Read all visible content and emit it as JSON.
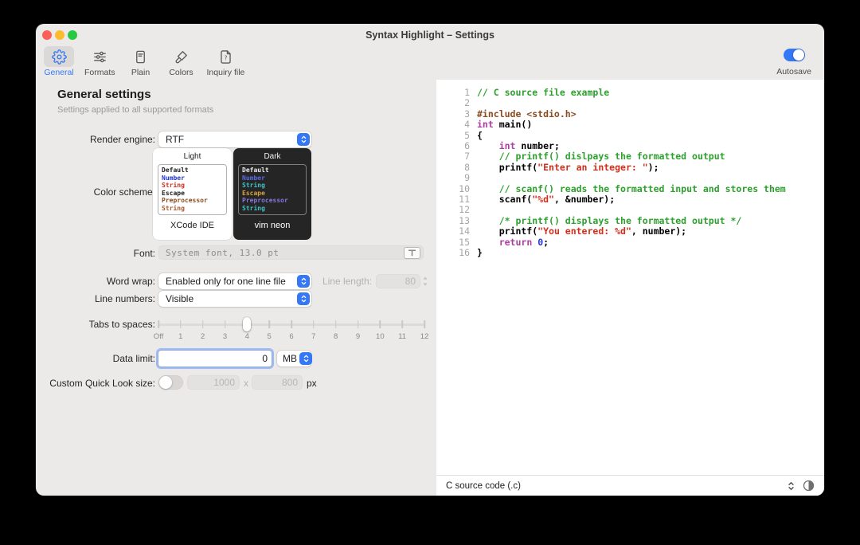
{
  "window": {
    "title": "Syntax Highlight – Settings"
  },
  "toolbar": {
    "items": [
      {
        "label": "General",
        "icon": "gear",
        "selected": true
      },
      {
        "label": "Formats",
        "icon": "sliders",
        "selected": false
      },
      {
        "label": "Plain",
        "icon": "document",
        "selected": false
      },
      {
        "label": "Colors",
        "icon": "paintbrush",
        "selected": false
      },
      {
        "label": "Inquiry file",
        "icon": "question-document",
        "selected": false
      }
    ],
    "autosave_label": "Autosave",
    "autosave_on": true
  },
  "general": {
    "heading": "General settings",
    "subheading": "Settings applied to all supported formats",
    "render_engine": {
      "label": "Render engine:",
      "value": "RTF"
    },
    "color_scheme": {
      "label": "Color scheme:",
      "light": {
        "header": "Light",
        "name": "XCode IDE",
        "lines": [
          {
            "text": "Default",
            "color": "#1a1a1a"
          },
          {
            "text": "Number",
            "color": "#2433d6"
          },
          {
            "text": "String",
            "color": "#d12f1b"
          },
          {
            "text": "Escape",
            "color": "#1a1a1a"
          },
          {
            "text": "Preprocessor",
            "color": "#8a4b21"
          },
          {
            "text": "String",
            "color": "#b0542c"
          }
        ]
      },
      "dark": {
        "header": "Dark",
        "name": "vim neon",
        "lines": [
          {
            "text": "Default",
            "color": "#ededed"
          },
          {
            "text": "Number",
            "color": "#5c6ae0"
          },
          {
            "text": "String",
            "color": "#3fc0c9"
          },
          {
            "text": "Escape",
            "color": "#dda23f"
          },
          {
            "text": "Preprocessor",
            "color": "#8377dd"
          },
          {
            "text": "String",
            "color": "#3fc0c9"
          }
        ]
      }
    },
    "font": {
      "label": "Font:",
      "value": "System font, 13.0 pt"
    },
    "word_wrap": {
      "label": "Word wrap:",
      "value": "Enabled only for one line file"
    },
    "line_length": {
      "label": "Line length:",
      "value": "80"
    },
    "line_numbers": {
      "label": "Line numbers:",
      "value": "Visible"
    },
    "tabs_to_spaces": {
      "label": "Tabs to spaces:",
      "ticks": [
        "Off",
        "1",
        "2",
        "3",
        "4",
        "5",
        "6",
        "7",
        "8",
        "9",
        "10",
        "11",
        "12"
      ],
      "value": "4"
    },
    "data_limit": {
      "label": "Data limit:",
      "value": "0",
      "unit": "MB"
    },
    "quick_look": {
      "label": "Custom Quick Look size:",
      "width": "1000",
      "separator": "x",
      "height": "800",
      "unit": "px",
      "enabled": false
    }
  },
  "preview": {
    "colors": {
      "comment": "#2da02d",
      "preprocessor": "#8a4b21",
      "keyword": "#ad3da4",
      "string": "#d12f1b",
      "number": "#2433d6",
      "plain": "#000000",
      "linenum": "#a5a5a5"
    },
    "code_lines": [
      {
        "n": "1",
        "segs": [
          {
            "t": "// C source file example",
            "c": "comment"
          }
        ]
      },
      {
        "n": "2",
        "segs": []
      },
      {
        "n": "3",
        "segs": [
          {
            "t": "#include <stdio.h>",
            "c": "preprocessor"
          }
        ]
      },
      {
        "n": "4",
        "segs": [
          {
            "t": "int",
            "c": "keyword"
          },
          {
            "t": " main()",
            "c": "plain"
          }
        ]
      },
      {
        "n": "5",
        "segs": [
          {
            "t": "{",
            "c": "plain"
          }
        ]
      },
      {
        "n": "6",
        "segs": [
          {
            "t": "    ",
            "c": "plain"
          },
          {
            "t": "int",
            "c": "keyword"
          },
          {
            "t": " number;",
            "c": "plain"
          }
        ]
      },
      {
        "n": "7",
        "segs": [
          {
            "t": "    ",
            "c": "plain"
          },
          {
            "t": "// printf() dislpays the formatted output",
            "c": "comment"
          }
        ]
      },
      {
        "n": "8",
        "segs": [
          {
            "t": "    printf(",
            "c": "plain"
          },
          {
            "t": "\"Enter an integer: \"",
            "c": "string"
          },
          {
            "t": ");",
            "c": "plain"
          }
        ]
      },
      {
        "n": "9",
        "segs": []
      },
      {
        "n": "10",
        "segs": [
          {
            "t": "    ",
            "c": "plain"
          },
          {
            "t": "// scanf() reads the formatted input and stores them",
            "c": "comment"
          }
        ]
      },
      {
        "n": "11",
        "segs": [
          {
            "t": "    scanf(",
            "c": "plain"
          },
          {
            "t": "\"%d\"",
            "c": "string"
          },
          {
            "t": ", &number);",
            "c": "plain"
          }
        ]
      },
      {
        "n": "12",
        "segs": []
      },
      {
        "n": "13",
        "segs": [
          {
            "t": "    ",
            "c": "plain"
          },
          {
            "t": "/* printf() displays the formatted output */",
            "c": "comment"
          }
        ]
      },
      {
        "n": "14",
        "segs": [
          {
            "t": "    printf(",
            "c": "plain"
          },
          {
            "t": "\"You entered: %d\"",
            "c": "string"
          },
          {
            "t": ", number);",
            "c": "plain"
          }
        ]
      },
      {
        "n": "15",
        "segs": [
          {
            "t": "    ",
            "c": "plain"
          },
          {
            "t": "return",
            "c": "keyword"
          },
          {
            "t": " ",
            "c": "plain"
          },
          {
            "t": "0",
            "c": "number"
          },
          {
            "t": ";",
            "c": "plain"
          }
        ]
      },
      {
        "n": "16",
        "segs": [
          {
            "t": "}",
            "c": "plain"
          }
        ]
      }
    ],
    "statusbar": {
      "format": "C source code (.c)"
    }
  },
  "accent": "#3478f6"
}
